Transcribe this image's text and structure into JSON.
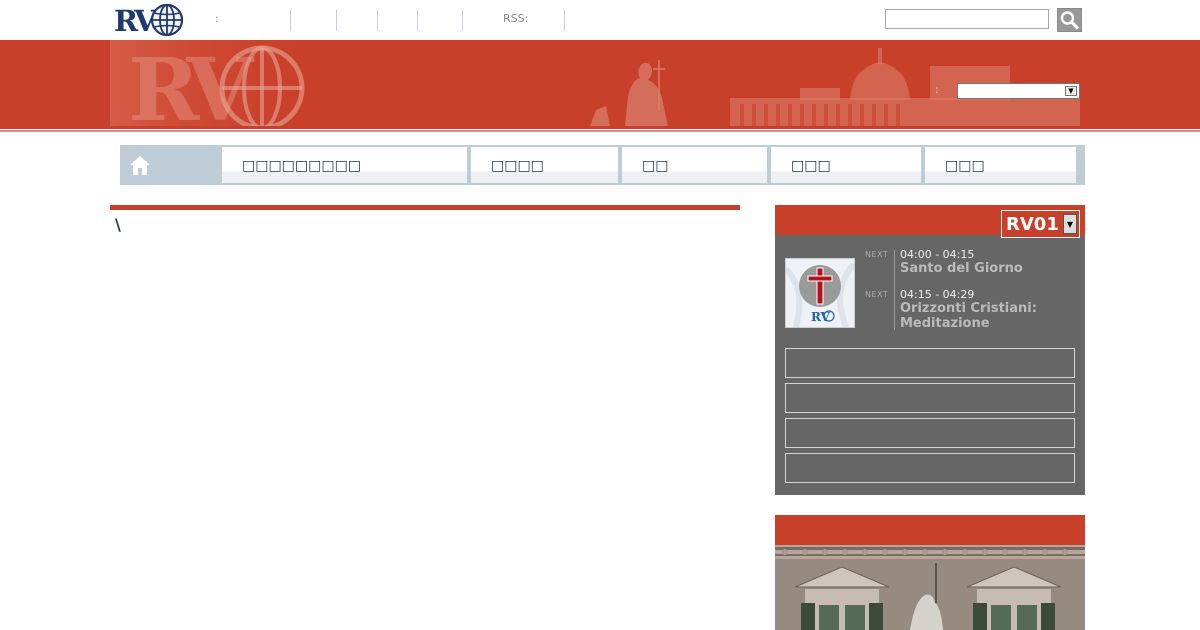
{
  "logo": {
    "text": "RV"
  },
  "topbar": {
    "colon_label": ":",
    "rss_label": "RSS:",
    "search": {
      "placeholder": "",
      "value": ""
    },
    "search_icon": "magnifier-icon"
  },
  "banner": {
    "language_label": ":",
    "language_value": ""
  },
  "nav": {
    "home_icon": "home-icon",
    "tabs": [
      {
        "label": "□□□□□□□□□"
      },
      {
        "label": "□□□□"
      },
      {
        "label": "□□"
      },
      {
        "label": "□□□"
      },
      {
        "label": "□□□"
      }
    ]
  },
  "content": {
    "text": "\\"
  },
  "player": {
    "channel": "RV01",
    "programs": [
      {
        "tag": "NEXT",
        "time": "04:00 - 04:15",
        "title": "Santo del Giorno"
      },
      {
        "tag": "NEXT",
        "time": "04:15 - 04:29",
        "title": "Orizzonti Cristiani: Meditazione"
      }
    ],
    "buttons": [
      {
        "label": ""
      },
      {
        "label": ""
      },
      {
        "label": ""
      },
      {
        "label": ""
      }
    ]
  },
  "colors": {
    "brand_red": "#c9402a",
    "navy": "#1f3a6e",
    "panel_grey": "#666666",
    "nav_blue": "#bdccd6"
  }
}
